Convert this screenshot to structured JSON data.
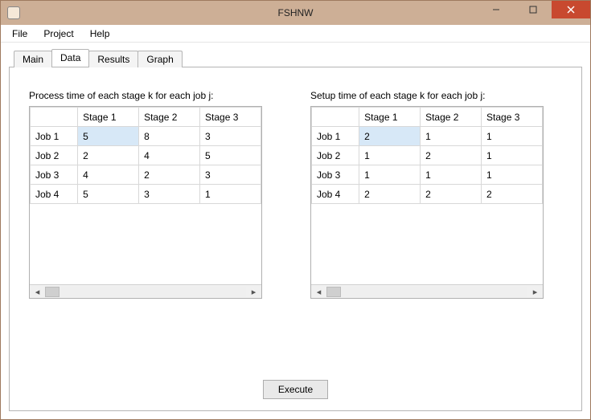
{
  "window": {
    "title": "FSHNW"
  },
  "menu": {
    "file": "File",
    "project": "Project",
    "help": "Help"
  },
  "tabs": {
    "main": "Main",
    "data": "Data",
    "results": "Results",
    "graph": "Graph",
    "active": "data"
  },
  "tables": {
    "process": {
      "caption": "Process time of each stage k  for each job j:",
      "cols": [
        "Stage 1",
        "Stage 2",
        "Stage 3"
      ],
      "rows": [
        {
          "label": "Job 1",
          "cells": [
            "5",
            "8",
            "3"
          ]
        },
        {
          "label": "Job 2",
          "cells": [
            "2",
            "4",
            "5"
          ]
        },
        {
          "label": "Job 3",
          "cells": [
            "4",
            "2",
            "3"
          ]
        },
        {
          "label": "Job 4",
          "cells": [
            "5",
            "3",
            "1"
          ]
        }
      ],
      "selected": {
        "row": 0,
        "col": 0
      }
    },
    "setup": {
      "caption": "Setup time of each stage k  for each job j:",
      "cols": [
        "Stage 1",
        "Stage 2",
        "Stage 3"
      ],
      "rows": [
        {
          "label": "Job 1",
          "cells": [
            "2",
            "1",
            "1"
          ]
        },
        {
          "label": "Job 2",
          "cells": [
            "1",
            "2",
            "1"
          ]
        },
        {
          "label": "Job 3",
          "cells": [
            "1",
            "1",
            "1"
          ]
        },
        {
          "label": "Job 4",
          "cells": [
            "2",
            "2",
            "2"
          ]
        }
      ],
      "selected": {
        "row": 0,
        "col": 0
      }
    }
  },
  "buttons": {
    "execute": "Execute"
  }
}
